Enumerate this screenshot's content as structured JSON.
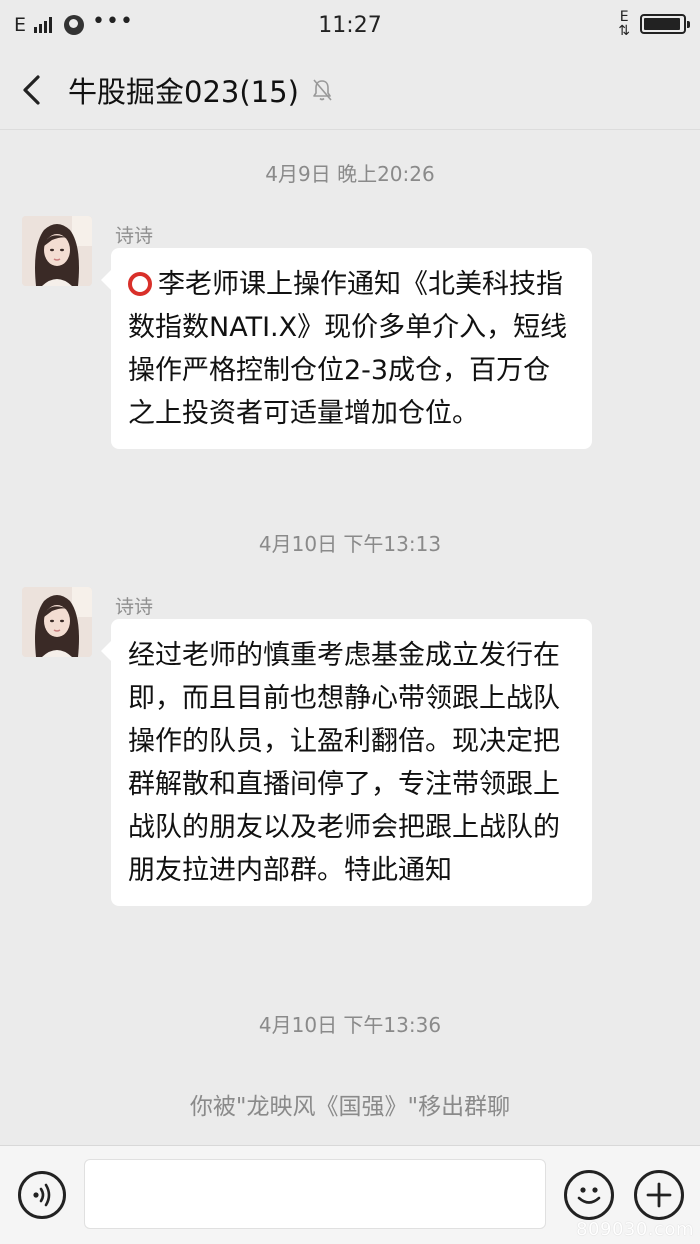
{
  "status_bar": {
    "carrier": "E",
    "time": "11:27",
    "network_badge": "E",
    "icons": [
      "signal-icon",
      "globe-icon",
      "more-dots-icon",
      "data-arrows-icon",
      "battery-icon"
    ],
    "battery_level": 0.95
  },
  "header": {
    "title": "牛股掘金023(15)",
    "icons": [
      "back-chevron-icon",
      "mute-bell-icon"
    ]
  },
  "messages": [
    {
      "timestamp": "4月9日 晚上20:26",
      "sender": "诗诗",
      "prefix_icon": "red-circle-icon",
      "text": "李老师课上操作通知《北美科技指数指数NATI.X》现价多单介入，短线操作严格控制仓位2-3成仓，百万仓之上投资者可适量增加仓位。"
    },
    {
      "timestamp": "4月10日 下午13:13",
      "sender": "诗诗",
      "text": "经过老师的慎重考虑基金成立发行在即，而且目前也想静心带领跟上战队操作的队员，让盈利翻倍。现决定把群解散和直播间停了，专注带领跟上战队的朋友以及老师会把跟上战队的朋友拉进内部群。特此通知"
    }
  ],
  "system": {
    "timestamp": "4月10日 下午13:36",
    "notice": "你被\"龙映风《国强》\"移出群聊"
  },
  "input_bar": {
    "placeholder": "",
    "icons": [
      "voice-icon",
      "emoji-icon",
      "plus-icon"
    ]
  },
  "watermark": "809030.com",
  "colors": {
    "background": "#ebebeb",
    "bubble": "#ffffff",
    "red_circle": "#d9302a",
    "meta_text": "#8a8a8a"
  }
}
